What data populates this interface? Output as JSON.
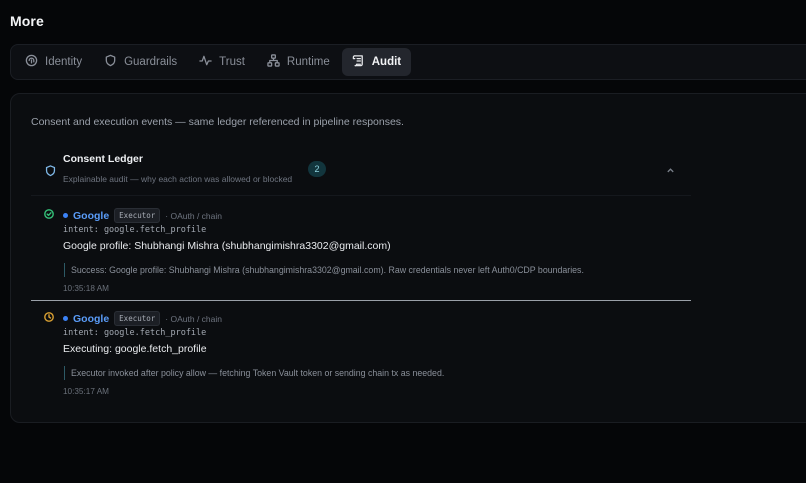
{
  "page": {
    "title": "More"
  },
  "tabs": [
    {
      "label": "Identity",
      "icon": "fingerprint-icon",
      "active": false
    },
    {
      "label": "Guardrails",
      "icon": "shield-icon",
      "active": false
    },
    {
      "label": "Trust",
      "icon": "activity-icon",
      "active": false
    },
    {
      "label": "Runtime",
      "icon": "network-icon",
      "active": false
    },
    {
      "label": "Audit",
      "icon": "scroll-icon",
      "active": true
    }
  ],
  "panel": {
    "description": "Consent and execution events — same ledger referenced in pipeline responses.",
    "ledger": {
      "title": "Consent Ledger",
      "subtitle": "Explainable audit — why each action was allowed or blocked",
      "count": "2",
      "icon": "shield-icon",
      "collapse_icon": "chevron-up-icon"
    },
    "events": [
      {
        "status": "success",
        "status_icon": "check-circle-icon",
        "status_color": "#35c27a",
        "provider": "Google",
        "role": "Executor",
        "chain": "· OAuth / chain",
        "intent": "intent: google.fetch_profile",
        "summary": "Google profile: Shubhangi Mishra (shubhangimishra3302@gmail.com)",
        "detail": "Success: Google profile: Shubhangi Mishra (shubhangimishra3302@gmail.com). Raw credentials never left Auth0/CDP boundaries.",
        "time": "10:35:18 AM"
      },
      {
        "status": "pending",
        "status_icon": "clock-icon",
        "status_color": "#d9a032",
        "provider": "Google",
        "role": "Executor",
        "chain": "· OAuth / chain",
        "intent": "intent: google.fetch_profile",
        "summary": "Executing: google.fetch_profile",
        "detail": "Executor invoked after policy allow — fetching Token Vault token or sending chain tx as needed.",
        "time": "10:35:17 AM"
      }
    ]
  },
  "colors": {
    "accent": "#5a9cf8",
    "badge_bg": "#12353d",
    "active_tab_bg": "#23262d"
  }
}
